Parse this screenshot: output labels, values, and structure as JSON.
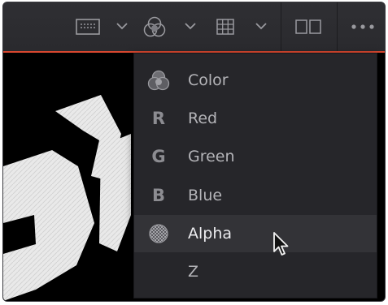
{
  "toolbar": {
    "buttons": [
      {
        "name": "viewer-mode-icon"
      },
      {
        "name": "color-channels-icon"
      },
      {
        "name": "grid-icon"
      },
      {
        "name": "split-view-icon"
      },
      {
        "name": "more-icon"
      }
    ]
  },
  "menu": {
    "items": [
      {
        "label": "Color",
        "icon": "color-channels-icon",
        "glyph": ""
      },
      {
        "label": "Red",
        "icon": "R",
        "glyph": "R"
      },
      {
        "label": "Green",
        "icon": "G",
        "glyph": "G"
      },
      {
        "label": "Blue",
        "icon": "B",
        "glyph": "B"
      },
      {
        "label": "Alpha",
        "icon": "alpha-checker-icon",
        "glyph": ""
      },
      {
        "label": "Z",
        "icon": "",
        "glyph": ""
      }
    ],
    "highlighted": "Alpha"
  },
  "colors": {
    "accent_line": "#d8472f",
    "menu_bg": "#26262a",
    "highlight_bg": "#333337"
  }
}
